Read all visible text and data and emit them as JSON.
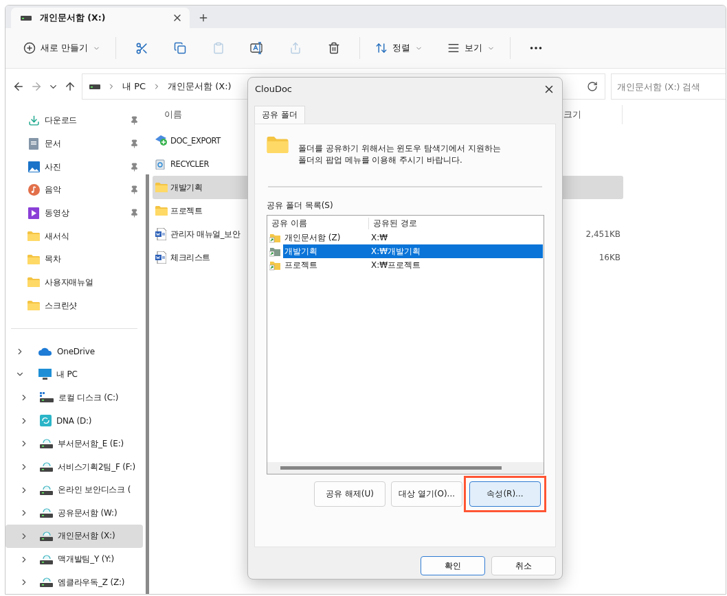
{
  "tab": {
    "title": "개인문서함 (X:)"
  },
  "toolbar": {
    "new_label": "새로 만들기",
    "sort_label": "정렬",
    "view_label": "보기"
  },
  "address": {
    "path": [
      "내 PC",
      "개인문서함 (X:)"
    ]
  },
  "search": {
    "placeholder": "개인문서함 (X:) 검색"
  },
  "sidebar": {
    "quick_access": [
      {
        "label": "다운로드",
        "kind": "download",
        "pinned": true
      },
      {
        "label": "문서",
        "kind": "document",
        "pinned": true
      },
      {
        "label": "사진",
        "kind": "pictures",
        "pinned": true
      },
      {
        "label": "음악",
        "kind": "music",
        "pinned": true
      },
      {
        "label": "동영상",
        "kind": "video",
        "pinned": true
      },
      {
        "label": "새서식",
        "kind": "folder",
        "pinned": false
      },
      {
        "label": "목차",
        "kind": "folder",
        "pinned": false
      },
      {
        "label": "사용자매뉴얼",
        "kind": "folder",
        "pinned": false
      },
      {
        "label": "스크린샷",
        "kind": "folder",
        "pinned": false
      }
    ],
    "tree": [
      {
        "label": "OneDrive",
        "kind": "cloud",
        "expanded": false,
        "selected": false
      },
      {
        "label": "내 PC",
        "kind": "pc",
        "expanded": true,
        "selected": false,
        "children": [
          {
            "label": "로컬 디스크 (C:)",
            "kind": "disk",
            "expanded": false,
            "selected": false
          },
          {
            "label": "DNA (D:)",
            "kind": "sync",
            "expanded": false,
            "selected": false
          },
          {
            "label": "부서문서함_E (E:)",
            "kind": "netdrive",
            "expanded": false,
            "selected": false
          },
          {
            "label": "서비스기획2팀_F (F:)",
            "kind": "netdrive",
            "expanded": false,
            "selected": false
          },
          {
            "label": "온라인 보안디스크 (",
            "kind": "netdrive",
            "expanded": false,
            "selected": false
          },
          {
            "label": "공유문서함 (W:)",
            "kind": "netdrive",
            "expanded": false,
            "selected": false
          },
          {
            "label": "개인문서함 (X:)",
            "kind": "netdrive",
            "expanded": false,
            "selected": true
          },
          {
            "label": "맥개발팀_Y (Y:)",
            "kind": "netdrive",
            "expanded": false,
            "selected": false
          },
          {
            "label": "엠클라우독_Z (Z:)",
            "kind": "netdrive",
            "expanded": false,
            "selected": false
          }
        ]
      }
    ]
  },
  "files": {
    "columns": [
      "이름",
      "크기"
    ],
    "rows": [
      {
        "name": "DOC_EXPORT",
        "kind": "archive",
        "selected": false
      },
      {
        "name": "RECYCLER",
        "kind": "recycle",
        "selected": false
      },
      {
        "name": "개발기획",
        "kind": "folder",
        "selected": true
      },
      {
        "name": "프로젝트",
        "kind": "folder",
        "selected": false
      },
      {
        "name": "관리자 매뉴얼_보안",
        "kind": "word",
        "size": "2,451KB",
        "selected": false
      },
      {
        "name": "체크리스트",
        "kind": "word",
        "size": "16KB",
        "selected": false
      }
    ]
  },
  "dialog": {
    "title": "ClouDoc",
    "tabs": [
      {
        "label": "공유 폴더",
        "selected": true
      }
    ],
    "message_lines": [
      "폴더를 공유하기 위해서는 윈도우 탐색기에서 지원하는",
      "폴더의 팝업 메뉴를 이용해 주시기 바랍니다."
    ],
    "list_label": "공유 폴더 목록(S)",
    "columns": [
      "공유 이름",
      "공유된 경로"
    ],
    "rows": [
      {
        "name": "개인문서함 (Z)",
        "path": "X:₩",
        "selected": false
      },
      {
        "name": "개발기획",
        "path": "X:₩개발기획",
        "selected": true
      },
      {
        "name": "프로젝트",
        "path": "X:₩프로젝트",
        "selected": false
      }
    ],
    "buttons": [
      {
        "label": "공유 해제(U)",
        "highlighted": false
      },
      {
        "label": "대상 열기(O)...",
        "highlighted": false
      },
      {
        "label": "속성(R)...",
        "highlighted": true
      }
    ],
    "footer_buttons": [
      {
        "label": "확인",
        "default": true
      },
      {
        "label": "취소",
        "default": false
      }
    ]
  }
}
